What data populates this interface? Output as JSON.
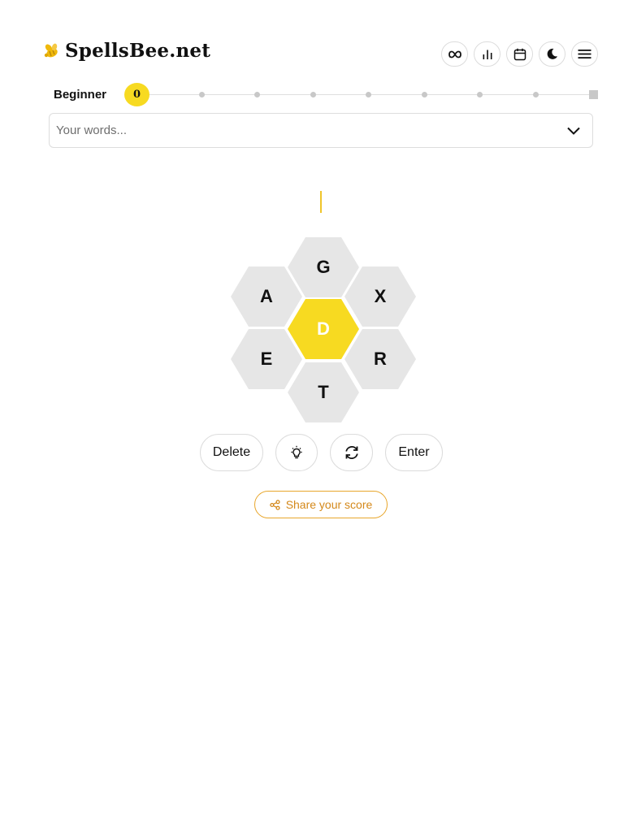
{
  "brand": {
    "name": "SpellsBee.net",
    "accent_color": "#f7da21"
  },
  "header": {
    "actions": [
      {
        "icon": "infinity-icon",
        "label": "Unlimited"
      },
      {
        "icon": "bar-chart-icon",
        "label": "Statistics"
      },
      {
        "icon": "calendar-icon",
        "label": "Calendar"
      },
      {
        "icon": "moon-icon",
        "label": "Dark mode"
      },
      {
        "icon": "menu-icon",
        "label": "Menu"
      }
    ]
  },
  "progress": {
    "rank": "Beginner",
    "score": "0",
    "steps": 9
  },
  "words": {
    "placeholder": "Your words..."
  },
  "hive": {
    "center": "D",
    "outer": [
      "G",
      "X",
      "R",
      "T",
      "E",
      "A"
    ]
  },
  "controls": {
    "delete_label": "Delete",
    "hint_icon": "lightbulb-icon",
    "shuffle_icon": "shuffle-icon",
    "enter_label": "Enter"
  },
  "share": {
    "label": "Share your score",
    "color": "#d4881a"
  }
}
